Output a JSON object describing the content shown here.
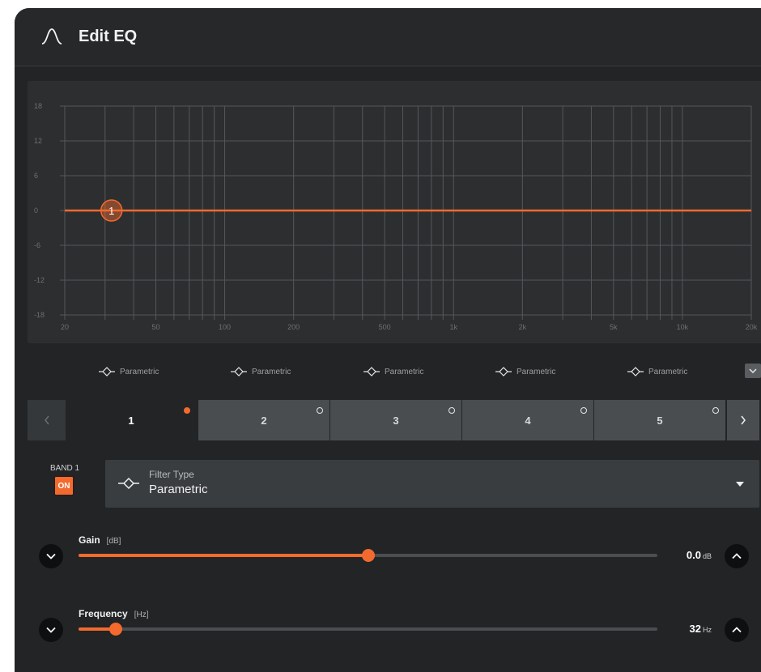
{
  "header": {
    "title": "Edit EQ",
    "icon": "bell-curve-icon"
  },
  "graph": {
    "y_ticks": [
      "18",
      "12",
      "6",
      "0",
      "-6",
      "-12",
      "-18"
    ],
    "x_ticks": [
      "20",
      "50",
      "100",
      "200",
      "500",
      "1k",
      "2k",
      "5k",
      "10k",
      "20k"
    ],
    "band_marker": {
      "label": "1",
      "freq_hz": 32,
      "gain_db": 0
    },
    "curve_color": "#f26a2e"
  },
  "band_types": [
    "Parametric",
    "Parametric",
    "Parametric",
    "Parametric",
    "Parametric"
  ],
  "tabs": [
    {
      "label": "1",
      "active": true
    },
    {
      "label": "2",
      "active": false
    },
    {
      "label": "3",
      "active": false
    },
    {
      "label": "4",
      "active": false
    },
    {
      "label": "5",
      "active": false
    }
  ],
  "band": {
    "label": "BAND 1",
    "on_label": "ON",
    "filter_type_label": "Filter Type",
    "filter_type_value": "Parametric"
  },
  "gain": {
    "name": "Gain",
    "unit": "[dB]",
    "value": "0.0",
    "value_unit": "dB",
    "level_fraction": 0.5
  },
  "frequency": {
    "name": "Frequency",
    "unit": "[Hz]",
    "value": "32",
    "value_unit": "Hz",
    "level_fraction": 0.065
  },
  "colors": {
    "accent": "#f26a2e",
    "background": "#222426",
    "panel": "#2c2e30"
  }
}
